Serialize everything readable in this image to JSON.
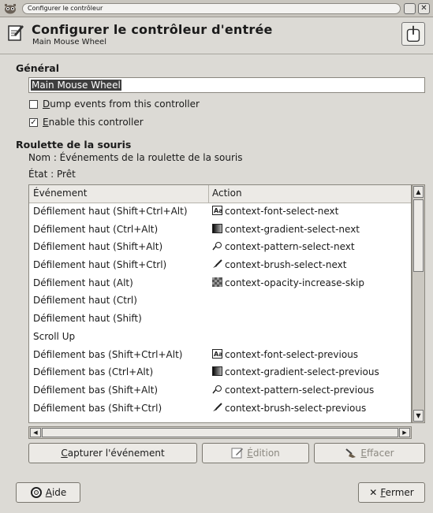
{
  "window": {
    "title": "Configurer le contrôleur"
  },
  "header": {
    "title": "Configurer le contrôleur d'entrée",
    "subtitle": "Main Mouse Wheel"
  },
  "general": {
    "section_title": "Général",
    "name_value": "Main Mouse Wheel",
    "dump_events": {
      "label_first": "D",
      "label_rest": "ump events from this controller",
      "checked": false
    },
    "enable": {
      "label_first": "E",
      "label_rest": "nable this controller",
      "checked": true
    }
  },
  "wheel": {
    "section_title": "Roulette de la souris",
    "name_line": "Nom : Événements de la roulette de la souris",
    "state_line": "État :  Prêt"
  },
  "table": {
    "col_event": "Événement",
    "col_action": "Action",
    "rows": [
      {
        "event": "Défilement haut (Shift+Ctrl+Alt)",
        "action": "context-font-select-next",
        "icon": "font-icon"
      },
      {
        "event": "Défilement haut (Ctrl+Alt)",
        "action": "context-gradient-select-next",
        "icon": "gradient-icon"
      },
      {
        "event": "Défilement haut (Shift+Alt)",
        "action": "context-pattern-select-next",
        "icon": "pattern-icon"
      },
      {
        "event": "Défilement haut (Shift+Ctrl)",
        "action": "context-brush-select-next",
        "icon": "brush-icon"
      },
      {
        "event": "Défilement haut (Alt)",
        "action": "context-opacity-increase-skip",
        "icon": "opacity-icon"
      },
      {
        "event": "Défilement haut (Ctrl)",
        "action": "",
        "icon": ""
      },
      {
        "event": "Défilement haut (Shift)",
        "action": "",
        "icon": ""
      },
      {
        "event": "Scroll Up",
        "action": "",
        "icon": ""
      },
      {
        "event": "Défilement bas (Shift+Ctrl+Alt)",
        "action": "context-font-select-previous",
        "icon": "font-icon"
      },
      {
        "event": "Défilement bas (Ctrl+Alt)",
        "action": "context-gradient-select-previous",
        "icon": "gradient-icon"
      },
      {
        "event": "Défilement bas (Shift+Alt)",
        "action": "context-pattern-select-previous",
        "icon": "pattern-icon"
      },
      {
        "event": "Défilement bas (Shift+Ctrl)",
        "action": "context-brush-select-previous",
        "icon": "brush-icon"
      }
    ]
  },
  "buttons": {
    "capture": {
      "first": "C",
      "rest": "apturer l'événement"
    },
    "edit": {
      "first": "É",
      "rest": "dition"
    },
    "clear": {
      "first": "E",
      "rest": "ffacer"
    },
    "help": {
      "first": "A",
      "rest": "ide"
    },
    "close": {
      "first": "F",
      "rest": "ermer"
    }
  }
}
